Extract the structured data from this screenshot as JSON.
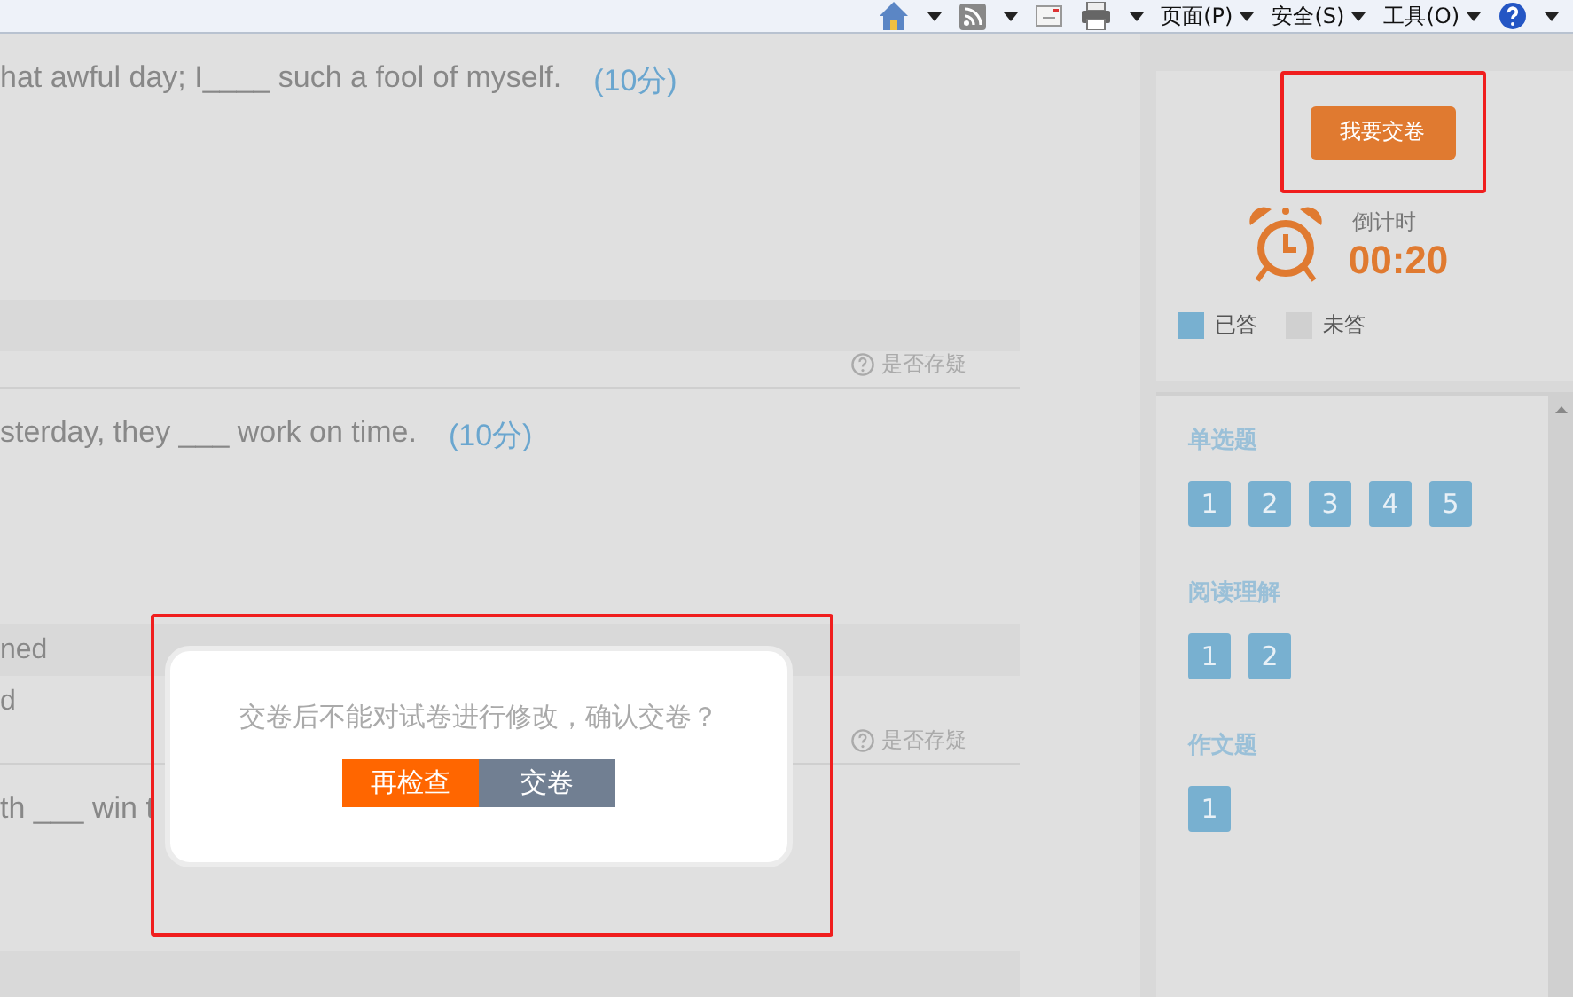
{
  "toolbar": {
    "menus": [
      "页面(P)",
      "安全(S)",
      "工具(O)"
    ]
  },
  "questions": [
    {
      "text": "hat awful day; I____ such a fool of myself.",
      "score": "(10分)",
      "kind": "full",
      "doubt_label": "是否存疑"
    },
    {
      "text": "sterday, they ___ work on time.",
      "score": "(10分)",
      "kind": "full",
      "option_strip": "ned",
      "option_line": "d",
      "doubt_label": "是否存疑"
    },
    {
      "text": "th ___ win t",
      "kind": "partial"
    }
  ],
  "dialog": {
    "message": "交卷后不能对试卷进行修改，确认交卷？",
    "buttons": [
      {
        "label": "再检查",
        "kind": "primary"
      },
      {
        "label": "交卷",
        "kind": "secondary"
      }
    ]
  },
  "sidebar": {
    "submit_button": "我要交卷",
    "timer_label": "倒计时",
    "timer_value": "00:20",
    "legend": [
      {
        "label": "已答",
        "color": "#78b0d0"
      },
      {
        "label": "未答",
        "color": "#d0d0d0"
      }
    ],
    "sections": [
      {
        "title": "单选题",
        "items": [
          {
            "number": "1",
            "answered": true
          },
          {
            "number": "2",
            "answered": true
          },
          {
            "number": "3",
            "answered": true
          },
          {
            "number": "4",
            "answered": true
          },
          {
            "number": "5",
            "answered": true
          }
        ]
      },
      {
        "title": "阅读理解",
        "items": [
          {
            "number": "1",
            "answered": true
          },
          {
            "number": "2",
            "answered": true
          }
        ]
      },
      {
        "title": "作文题",
        "items": [
          {
            "number": "1",
            "answered": true
          }
        ]
      }
    ]
  }
}
